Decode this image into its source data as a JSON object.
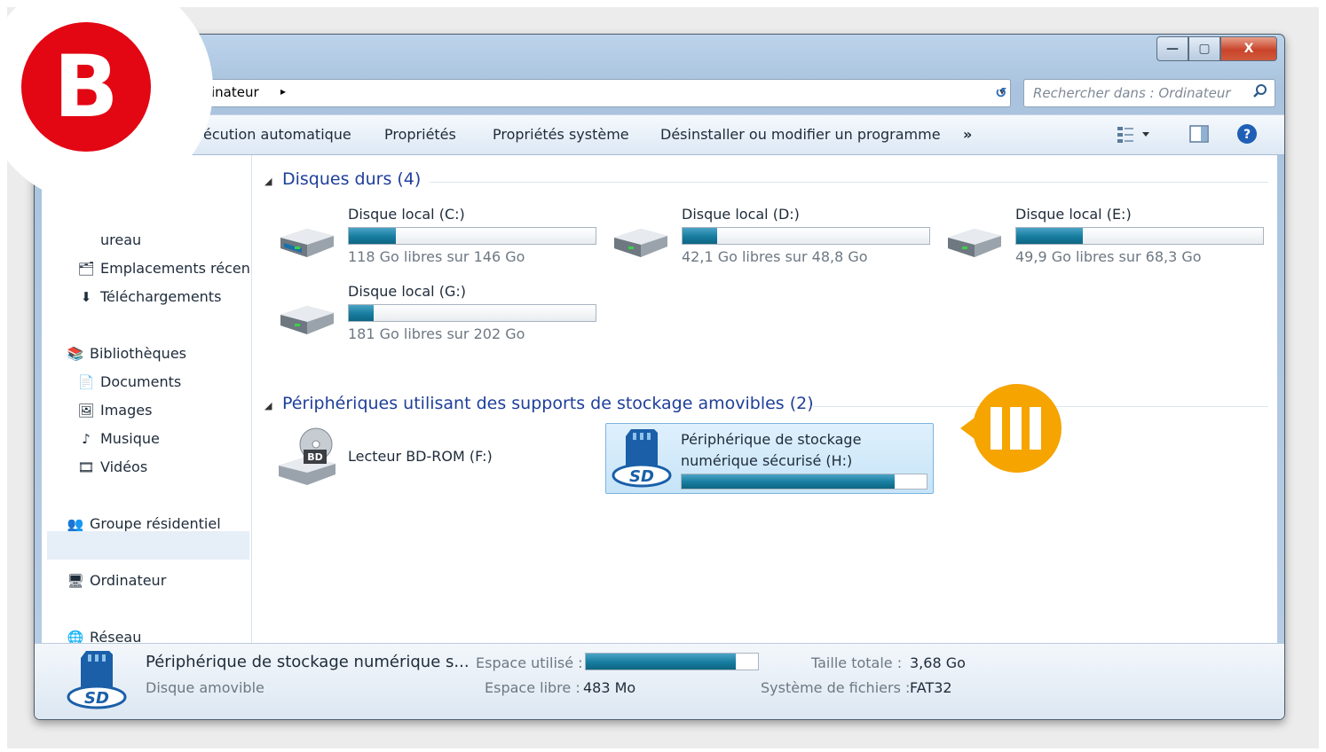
{
  "window": {
    "controls": {
      "minimize": "—",
      "maximize": "▢",
      "close": "X"
    }
  },
  "address": {
    "path": "inateur",
    "arrow": "▸",
    "dropdown": "▾",
    "refresh": "↺"
  },
  "search": {
    "placeholder": "Rechercher dans : Ordinateur"
  },
  "toolbar": {
    "autoplay": "écution automatique",
    "properties": "Propriétés",
    "system_properties": "Propriétés système",
    "uninstall": "Désinstaller ou modifier un programme",
    "more": "»"
  },
  "sidebar": {
    "desktop": "ureau",
    "recent": "Emplacements récen",
    "downloads": "Téléchargements",
    "libraries": "Bibliothèques",
    "documents": "Documents",
    "images": "Images",
    "music": "Musique",
    "videos": "Vidéos",
    "homegroup": "Groupe résidentiel",
    "computer": "Ordinateur",
    "network": "Réseau"
  },
  "groups": {
    "hard_disks": "Disques durs (4)",
    "removable": "Périphériques utilisant des supports de stockage amovibles (2)"
  },
  "drives": [
    {
      "name": "Disque local (C:)",
      "free": "118 Go libres sur 146 Go",
      "used_fraction": 0.19
    },
    {
      "name": "Disque local (D:)",
      "free": "42,1 Go libres sur 48,8 Go",
      "used_fraction": 0.14
    },
    {
      "name": "Disque local (E:)",
      "free": "49,9 Go libres sur 68,3 Go",
      "used_fraction": 0.27
    },
    {
      "name": "Disque local (G:)",
      "free": "181 Go libres sur 202 Go",
      "used_fraction": 0.1
    }
  ],
  "bd_drive": {
    "name": "Lecteur BD-ROM (F:)",
    "label": "BD"
  },
  "sd_drive": {
    "name": "Périphérique de stockage numérique sécurisé (H:)",
    "used_fraction": 0.87,
    "logo": "SD"
  },
  "status": {
    "name": "Périphérique de stockage numérique s...",
    "type": "Disque amovible",
    "used_label": "Espace utilisé :",
    "used_fraction": 0.87,
    "free_label": "Espace libre :",
    "free_value": "483 Mo",
    "total_label": "Taille totale :",
    "total_value": "3,68 Go",
    "fs_label": "Système de fichiers :",
    "fs_value": "FAT32"
  },
  "badge": {
    "letter": "B"
  },
  "colors": {
    "badge_red": "#e30613",
    "marker_orange": "#f5a400",
    "group_blue": "#1e3f9a",
    "bar_teal": "#177d9f"
  }
}
